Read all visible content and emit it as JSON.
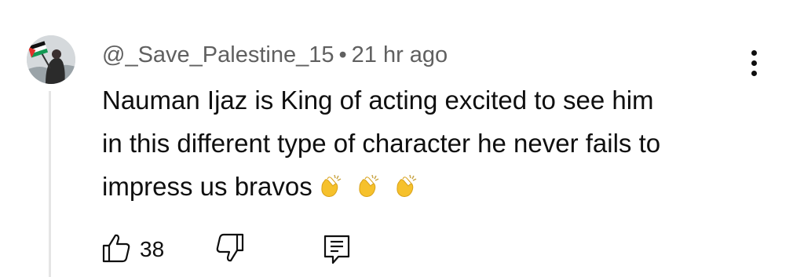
{
  "comment": {
    "author": "@_Save_Palestine_15",
    "separator": "•",
    "timestamp": "21 hr ago",
    "text_lines": [
      "Nauman Ijaz is King of acting excited to see him",
      "in this different type of character he never fails to",
      "impress us bravos"
    ],
    "emojis": [
      "clapping-hands-icon",
      "clapping-hands-icon",
      "clapping-hands-icon"
    ],
    "avatar_icon": "avatar-flag-photo"
  },
  "actions": {
    "like_icon": "thumbs-up-icon",
    "like_count": "38",
    "dislike_icon": "thumbs-down-icon",
    "reply_icon": "comment-reply-icon",
    "more_icon": "more-vertical-icon"
  },
  "colors": {
    "text": "#0f0f0f",
    "meta": "#606060",
    "thread_line": "#e5e5e5",
    "emoji": "#f6c12c"
  }
}
